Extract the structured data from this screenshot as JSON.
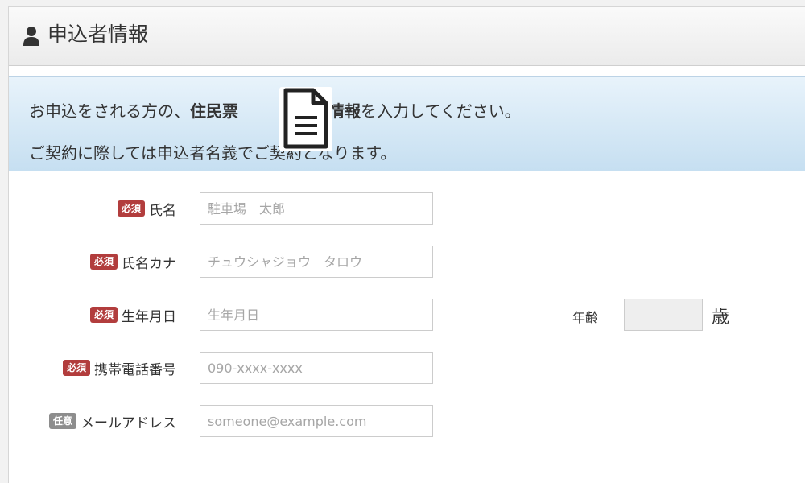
{
  "header": {
    "title": "申込者情報",
    "icon": "user-icon"
  },
  "notice": {
    "line1_part1": "お申込をされる方の、",
    "line1_bold1": "住民票",
    "line1_bold2": "上の情報",
    "line1_part2": "を入力してください。",
    "line2": "ご契約に際しては申込者名義でご契約となります。",
    "icon": "document-icon"
  },
  "form": {
    "required_badge": "必須",
    "optional_badge": "任意",
    "fields": [
      {
        "label": "氏名",
        "placeholder": "駐車場　太郎",
        "value": ""
      },
      {
        "label": "氏名カナ",
        "placeholder": "チュウシャジョウ　タロウ",
        "value": ""
      },
      {
        "label": "生年月日",
        "placeholder": "生年月日",
        "value": ""
      },
      {
        "label": "携帯電話番号",
        "placeholder": "090-xxxx-xxxx",
        "value": ""
      },
      {
        "label": "メールアドレス",
        "placeholder": "someone@example.com",
        "value": ""
      }
    ],
    "age": {
      "label": "年齢",
      "unit": "歳",
      "value": ""
    }
  },
  "colors": {
    "required_badge": "#b23d3d",
    "optional_badge": "#8d8d8d",
    "notice_bg": "#c6dff1"
  }
}
